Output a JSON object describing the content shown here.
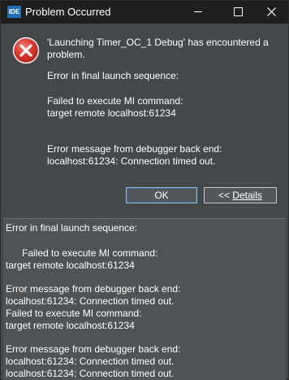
{
  "titlebar": {
    "app_icon_text": "IDE",
    "title": "Problem Occurred",
    "controls": [
      "minimize-icon",
      "maximize-icon",
      "close-icon"
    ]
  },
  "dialog": {
    "icon": "error-icon",
    "message_line1": "'Launching Timer_OC_1 Debug' has encountered a",
    "message_line2": "problem.",
    "reason": "Error in final launch sequence:",
    "fail_line1": "Failed to execute MI command:",
    "fail_line2": "target remote localhost:61234",
    "backend_line1": "Error message from debugger back end:",
    "backend_line2": "localhost:61234: Connection timed out."
  },
  "buttons": {
    "ok_label": "OK",
    "details_prefix": "<< ",
    "details_label": "Details"
  },
  "details": {
    "lines": [
      "Error in final launch sequence:",
      "",
      "Failed to execute MI command:",
      "target remote localhost:61234",
      "",
      "Error message from debugger back end:",
      "localhost:61234: Connection timed out.",
      "Failed to execute MI command:",
      "target remote localhost:61234",
      "",
      "Error message from debugger back end:",
      "localhost:61234: Connection timed out.",
      "localhost:61234: Connection timed out."
    ]
  },
  "colors": {
    "titlebar": "#1f1f1f",
    "dialog_bg": "#45484b",
    "error_red": "#d9352b"
  }
}
